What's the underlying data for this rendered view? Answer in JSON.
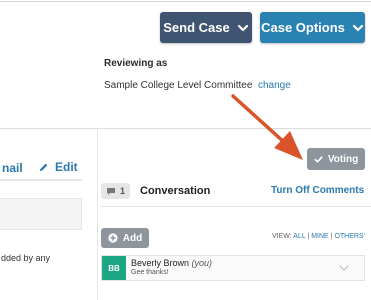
{
  "header": {
    "send_case_label": "Send Case",
    "case_options_label": "Case Options"
  },
  "reviewing": {
    "label": "Reviewing as",
    "committee": "Sample College Level Committee",
    "change_label": "change"
  },
  "left_panel": {
    "email_label": "nail",
    "edit_label": "Edit",
    "truncated_text": "dded by any"
  },
  "voting": {
    "button_label": "Voting"
  },
  "conversation": {
    "count": "1",
    "title": "Conversation",
    "turn_off_label": "Turn Off Comments",
    "add_label": "Add",
    "view_prefix": "VIEW:",
    "view_all": "ALL",
    "view_sep1": "|",
    "view_mine": "MINE",
    "view_sep2": "|",
    "view_others": "OTHERS'",
    "comment": {
      "initials": "BB",
      "author": "Beverly Brown",
      "author_tag": "(you)",
      "text": "Gee thanks!"
    }
  },
  "colors": {
    "send_case_bg": "#3e5470",
    "case_options_bg": "#2a82b3",
    "link": "#2a7ab0",
    "voting_bg": "#8e959c",
    "avatar_bg": "#1ba784",
    "annotation_arrow": "#d9542b"
  },
  "icons": {
    "send_case": "chevron-down-icon",
    "case_options": "chevron-down-icon",
    "edit": "pencil-icon",
    "voting": "checkmark-icon",
    "conversation": "speech-bubble-icon",
    "add": "plus-circle-icon",
    "comment_expand": "chevron-down-icon",
    "annotation": "arrow-icon"
  }
}
